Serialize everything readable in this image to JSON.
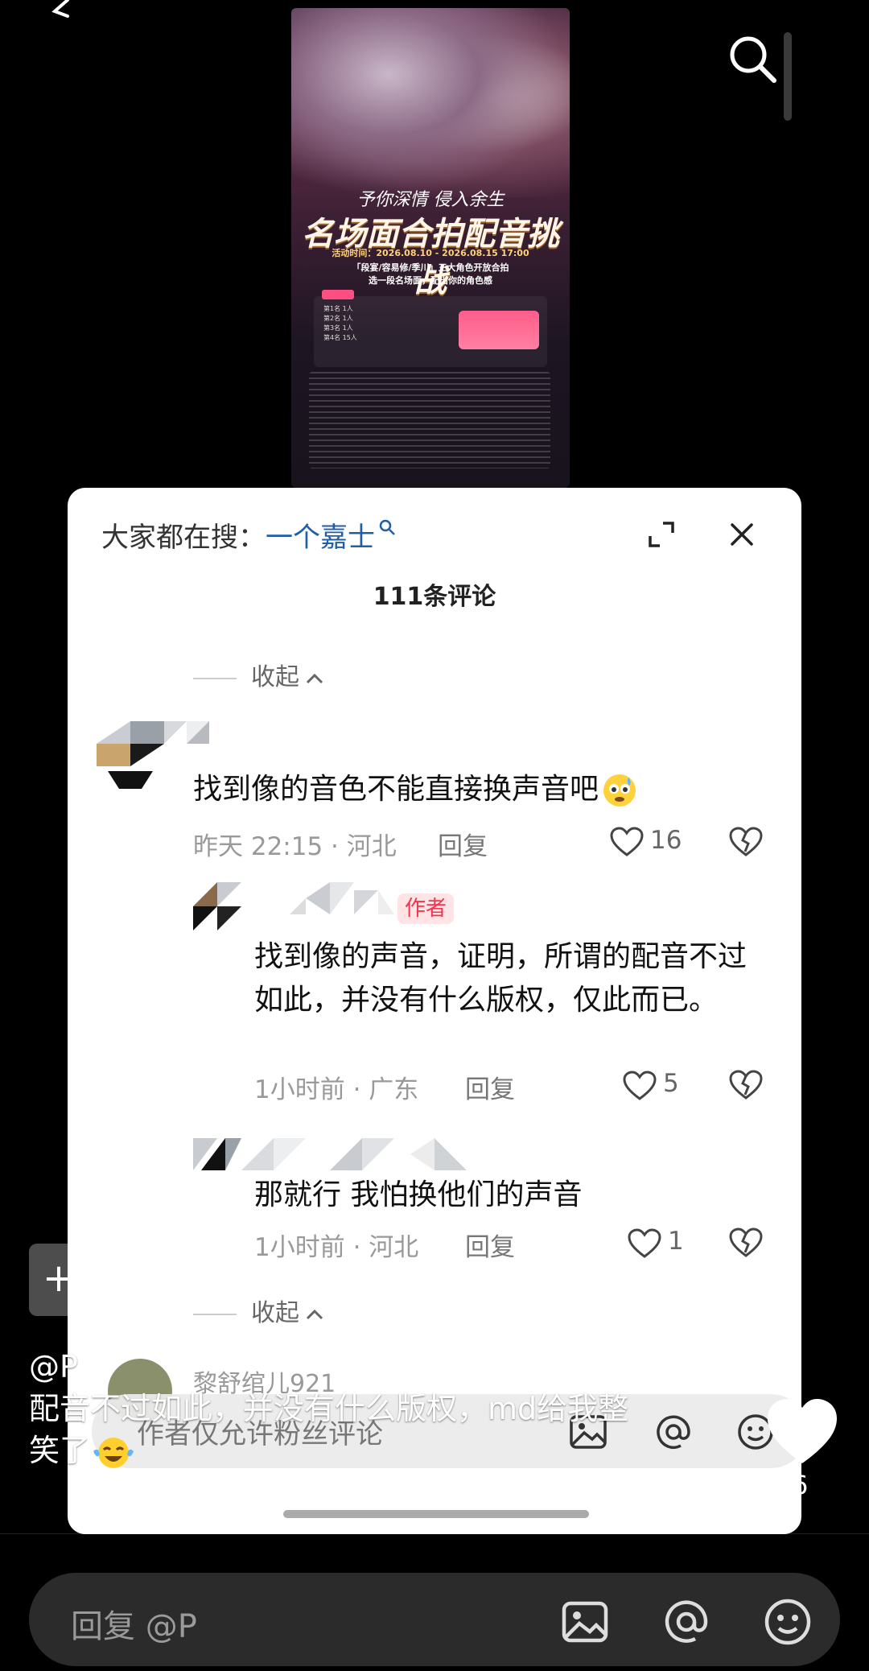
{
  "poster": {
    "slogan": "予你深情 侵入余生",
    "title": "名场面合拍配音挑战",
    "time": "活动时间：2026.08.10 - 2026.08.15  17:00",
    "roles": "「段宴/容易修/季川」三大角色开放合拍",
    "pick": "选一段名场面，配出你的角色感",
    "table_rows": [
      "第1名  1人",
      "第2名  1人",
      "第3名  1人",
      "第4名  15人"
    ]
  },
  "sheet": {
    "hot_search_label": "大家都在搜：",
    "hot_search_query": "一个嘉士",
    "comment_count_title": "111条评论",
    "collapse_label": "收起",
    "comments": [
      {
        "text": "找到像的音色不能直接换声音吧",
        "meta": "昨天 22:15 · 河北",
        "reply_label": "回复",
        "likes": "16"
      },
      {
        "badge": "作者",
        "text": "找到像的声音，证明，所谓的配音不过如此，并没有什么版权，仅此而已。",
        "meta": "1小时前 · 广东",
        "reply_label": "回复",
        "likes": "5"
      },
      {
        "text": "那就行 我怕换他们的声音",
        "meta": "1小时前 · 河北",
        "reply_label": "回复",
        "likes": "1"
      }
    ],
    "next_comment_name": "黎舒绾儿921",
    "fan_only_placeholder": "作者仅允许粉丝评论"
  },
  "overlay": {
    "caption_line1": "@P",
    "caption_line2": "配音不过如此，并没有什么版权，md给我整",
    "caption_line3": "笑了",
    "like_count": "6"
  },
  "bottom_bar": {
    "reply_placeholder": "回复 @P"
  },
  "colors": {
    "link_blue": "#1f5fa9",
    "author_badge_red": "#f2354c",
    "sheet_bg": "#ffffff"
  }
}
